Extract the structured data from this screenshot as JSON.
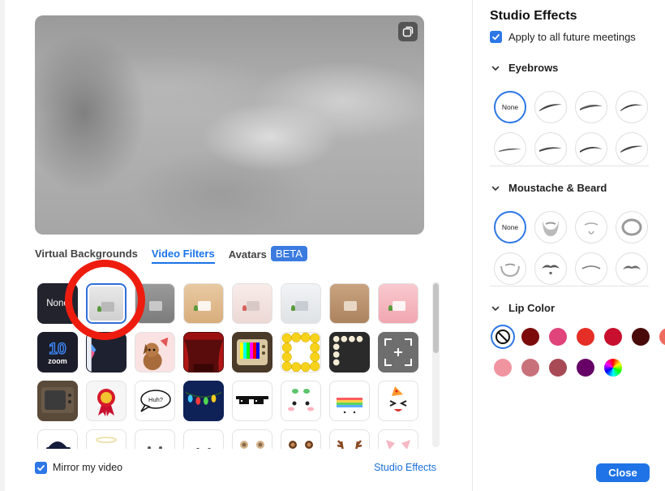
{
  "filters_panel": {
    "tabs": [
      {
        "label": "Virtual Backgrounds",
        "active": false
      },
      {
        "label": "Video Filters",
        "active": true
      },
      {
        "label": "Avatars",
        "active": false
      }
    ],
    "beta_badge": "BETA",
    "none_tile_label": "None",
    "mirror_label": "Mirror my video",
    "mirror_checked": true,
    "studio_effects_link": "Studio Effects",
    "tiles": [
      "none",
      "room-gray",
      "room-dark",
      "room-tan",
      "room-pink-light",
      "room-white",
      "room-brown",
      "room-pink",
      "zoom-10-logo",
      "dark-panel",
      "dog-cartoon",
      "theater-curtain",
      "retro-tv-bars",
      "smiley-frame",
      "bulb-frame",
      "focus-frame",
      "old-tv",
      "award-ribbon",
      "huh-bubble",
      "holiday-lights",
      "pixel-sunglasses",
      "sprout-face",
      "rainbow-stripe",
      "party-emoji",
      "cap",
      "halo",
      "cat-face",
      "mask-face",
      "bear-ears",
      "bear-brown",
      "reindeer-antlers",
      "pig-ears"
    ],
    "selected_tile_index": 1,
    "colors": {
      "accent": "#1a73e8",
      "highlight_ring": "#ee1c0f"
    }
  },
  "studio_effects": {
    "title": "Studio Effects",
    "apply_label": "Apply to all future meetings",
    "apply_checked": true,
    "eyebrows_label": "Eyebrows",
    "eyebrows_options": [
      "None",
      "eyebrow-style-1",
      "eyebrow-style-2",
      "eyebrow-style-3",
      "eyebrow-style-4",
      "eyebrow-style-5",
      "eyebrow-style-6",
      "eyebrow-style-7"
    ],
    "beard_label": "Moustache & Beard",
    "beard_options": [
      "None",
      "beard-style-1",
      "beard-style-2",
      "beard-style-3",
      "moustache-style-1",
      "moustache-style-2",
      "moustache-style-3",
      "moustache-style-4"
    ],
    "lip_label": "Lip Color",
    "lip_colors": [
      "none",
      "#7d0a0a",
      "#e0447a",
      "#e52e25",
      "#c8102e",
      "#4a0a0a",
      "#ee6b60",
      "#f094a0",
      "#c9717a",
      "#a84a55",
      "#660066",
      "color-wheel"
    ],
    "close_label": "Close"
  }
}
